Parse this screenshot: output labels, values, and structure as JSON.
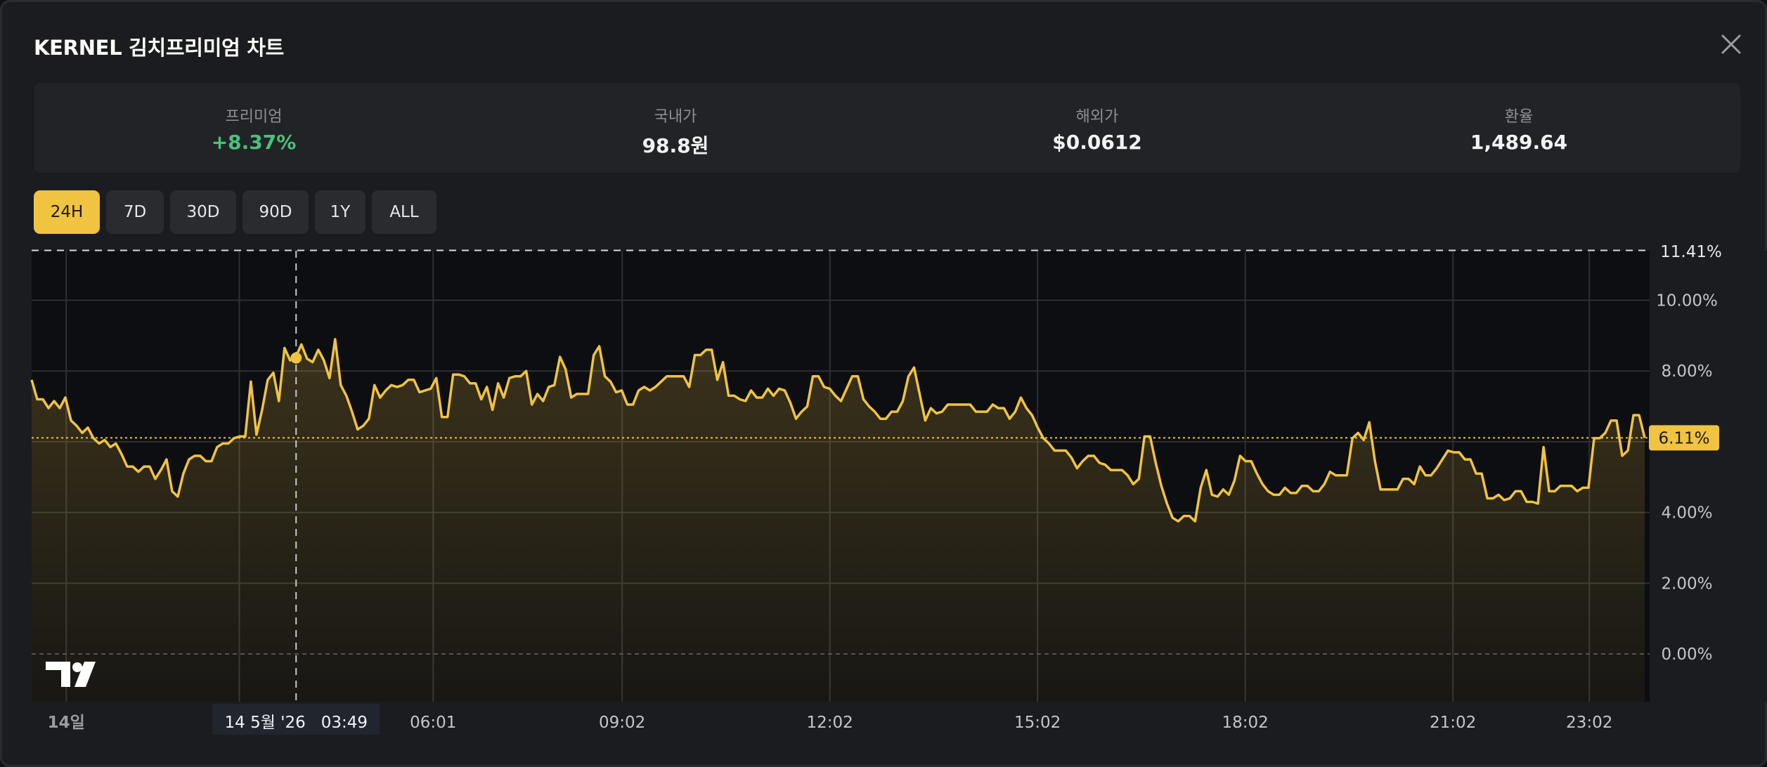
{
  "header": {
    "title": "KERNEL 김치프리미엄 차트"
  },
  "stats": [
    {
      "label": "프리미엄",
      "value": "+8.37%",
      "color": "#49c27a"
    },
    {
      "label": "국내가",
      "value": "98.8원",
      "color": "#f2f3f5"
    },
    {
      "label": "해외가",
      "value": "$0.0612",
      "color": "#f2f3f5"
    },
    {
      "label": "환율",
      "value": "1,489.64",
      "color": "#f2f3f5"
    }
  ],
  "tabs": [
    {
      "label": "24H",
      "active": true
    },
    {
      "label": "7D",
      "active": false
    },
    {
      "label": "30D",
      "active": false
    },
    {
      "label": "90D",
      "active": false
    },
    {
      "label": "1Y",
      "active": false
    },
    {
      "label": "ALL",
      "active": false
    }
  ],
  "chart_data": {
    "type": "area",
    "x_tick_labels": [
      "14일",
      "06:01",
      "09:02",
      "12:02",
      "15:02",
      "18:02",
      "21:02",
      "23:02"
    ],
    "y_tick_labels": [
      "0.00%",
      "2.00%",
      "4.00%",
      "6.00%",
      "8.00%",
      "10.00%"
    ],
    "ylim": [
      -1.35,
      11.4
    ],
    "max_label": "11.41%",
    "max_value": 11.41,
    "last_label": "6.11%",
    "last_value": 6.11,
    "crosshair": {
      "time_label": "14 5월 '26   03:49",
      "x_hours": 3.82,
      "value": 8.37
    },
    "x_hours": [
      0,
      23.3
    ],
    "line_color": "#f0c341",
    "values": [
      7.75,
      7.2,
      7.2,
      6.95,
      7.15,
      6.95,
      7.25,
      6.6,
      6.45,
      6.25,
      6.4,
      6.1,
      5.95,
      6.05,
      5.85,
      5.95,
      5.65,
      5.3,
      5.3,
      5.15,
      5.3,
      5.3,
      4.95,
      5.2,
      5.5,
      4.6,
      4.45,
      5.1,
      5.5,
      5.6,
      5.6,
      5.45,
      5.45,
      5.85,
      5.95,
      5.95,
      6.1,
      6.15,
      6.15,
      7.7,
      6.2,
      6.9,
      7.75,
      7.95,
      7.15,
      8.65,
      8.3,
      8.4,
      8.75,
      8.35,
      8.25,
      8.6,
      8.3,
      7.8,
      8.9,
      7.6,
      7.3,
      6.85,
      6.35,
      6.45,
      6.65,
      7.6,
      7.25,
      7.45,
      7.6,
      7.55,
      7.6,
      7.75,
      7.75,
      7.4,
      7.45,
      7.5,
      7.8,
      6.7,
      6.7,
      7.9,
      7.9,
      7.85,
      7.65,
      7.65,
      7.2,
      7.55,
      6.9,
      7.65,
      7.25,
      7.8,
      7.85,
      7.85,
      8.0,
      7.05,
      7.35,
      7.15,
      7.55,
      7.6,
      8.4,
      8.05,
      7.25,
      7.35,
      7.35,
      7.35,
      8.45,
      8.7,
      7.85,
      7.7,
      7.4,
      7.45,
      7.05,
      7.05,
      7.45,
      7.55,
      7.45,
      7.55,
      7.7,
      7.85,
      7.85,
      7.85,
      7.85,
      7.55,
      8.45,
      8.45,
      8.6,
      8.6,
      7.75,
      8.25,
      7.3,
      7.3,
      7.2,
      7.15,
      7.45,
      7.25,
      7.25,
      7.5,
      7.3,
      7.5,
      7.45,
      7.1,
      6.65,
      6.85,
      7.0,
      7.85,
      7.85,
      7.55,
      7.5,
      7.3,
      7.15,
      7.5,
      7.85,
      7.85,
      7.2,
      7.0,
      6.85,
      6.65,
      6.65,
      6.85,
      6.85,
      7.15,
      7.85,
      8.1,
      7.35,
      6.6,
      6.95,
      6.8,
      6.85,
      7.05,
      7.05,
      7.05,
      7.05,
      7.05,
      6.85,
      6.85,
      6.85,
      7.05,
      6.95,
      6.95,
      6.65,
      6.85,
      7.25,
      6.95,
      6.75,
      6.4,
      6.1,
      5.95,
      5.75,
      5.75,
      5.75,
      5.55,
      5.25,
      5.45,
      5.6,
      5.6,
      5.4,
      5.35,
      5.2,
      5.2,
      5.2,
      5.05,
      4.8,
      4.95,
      6.15,
      6.15,
      5.4,
      4.75,
      4.25,
      3.85,
      3.75,
      3.9,
      3.9,
      3.75,
      4.7,
      5.2,
      4.5,
      4.45,
      4.65,
      4.5,
      4.9,
      5.6,
      5.45,
      5.45,
      5.1,
      4.8,
      4.6,
      4.5,
      4.5,
      4.7,
      4.55,
      4.55,
      4.75,
      4.75,
      4.6,
      4.6,
      4.8,
      5.15,
      5.05,
      5.05,
      5.05,
      6.1,
      6.25,
      6.05,
      6.55,
      5.45,
      4.65,
      4.65,
      4.65,
      4.65,
      4.95,
      4.95,
      4.8,
      5.3,
      5.05,
      5.05,
      5.25,
      5.5,
      5.75,
      5.7,
      5.7,
      5.5,
      5.5,
      5.1,
      5.1,
      4.4,
      4.4,
      4.5,
      4.35,
      4.4,
      4.6,
      4.6,
      4.3,
      4.3,
      4.25,
      5.85,
      4.6,
      4.6,
      4.75,
      4.75,
      4.75,
      4.6,
      4.7,
      4.7,
      6.1,
      6.1,
      6.25,
      6.6,
      6.6,
      5.6,
      5.75,
      6.75,
      6.75,
      6.11
    ]
  }
}
